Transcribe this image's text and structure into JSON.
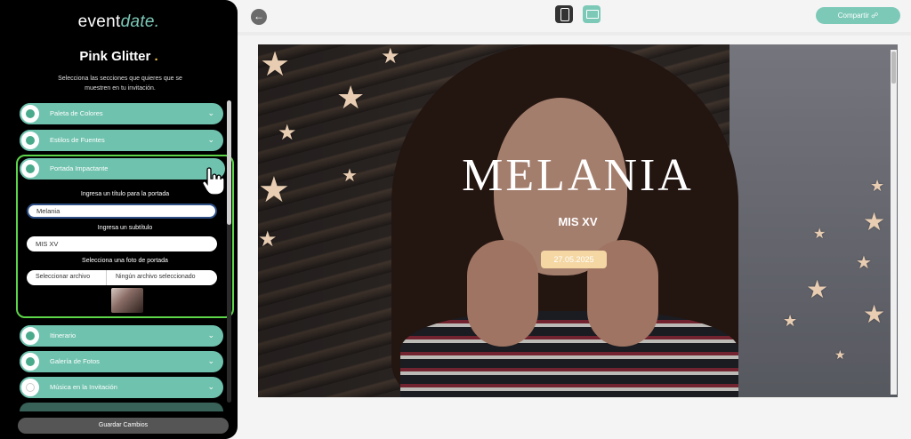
{
  "brand": {
    "logo_main": "event",
    "logo_accent": "date",
    "logo_dot": "."
  },
  "template": {
    "name": "Pink Glitter",
    "dot": "."
  },
  "instructions": "Selecciona las secciones que quieres que se muestren en tu invitación.",
  "sections": [
    {
      "label": "Paleta de Colores",
      "checked": true
    },
    {
      "label": "Estilos de Fuentes",
      "checked": true
    },
    {
      "label": "Portada Impactante",
      "checked": true,
      "expanded": true
    },
    {
      "label": "Itinerario",
      "checked": true
    },
    {
      "label": "Galería de Fotos",
      "checked": true
    },
    {
      "label": "Música en la Invitación",
      "checked": false
    }
  ],
  "cover_form": {
    "title_caption": "Ingresa un título para la portada",
    "title_value": "Melania",
    "subtitle_caption": "Ingresa un subtítulo",
    "subtitle_value": "MIS XV",
    "photo_caption": "Selecciona una foto de portada",
    "file_button": "Seleccionar archivo",
    "file_status": "Ningún archivo seleccionado"
  },
  "save_button": "Guardar Cambios",
  "topbar": {
    "back_icon": "arrow-left-icon",
    "share_label": "Compartir",
    "share_icon": "share-icon",
    "mobile_icon": "mobile-icon",
    "desktop_icon": "desktop-icon"
  },
  "preview": {
    "title": "MELANIA",
    "subtitle": "MIS XV",
    "date": "27.05.2025"
  },
  "colors": {
    "accent": "#7cc9b8",
    "section": "#6fc2ae",
    "focus_ring": "#5dd64a",
    "date_badge": "#f4d7a3"
  }
}
